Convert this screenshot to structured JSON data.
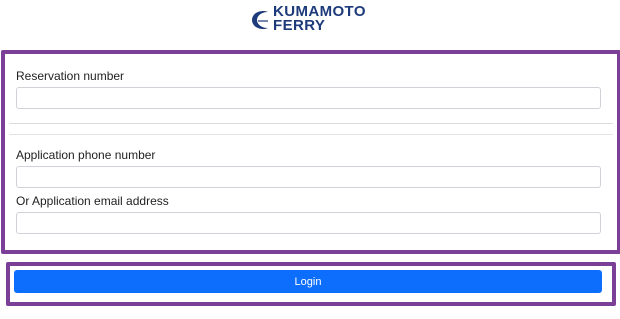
{
  "brand": {
    "line1": "KUMAMOTO",
    "line2": "FERRY",
    "accent_color": "#1d3a7a"
  },
  "form": {
    "reservation_label": "Reservation number",
    "reservation_value": "",
    "phone_label": "Application phone number",
    "phone_value": "",
    "email_label": "Or Application email address",
    "email_value": ""
  },
  "login": {
    "label": "Login",
    "color": "#0d6efd"
  },
  "highlight_color": "#7b3f98"
}
